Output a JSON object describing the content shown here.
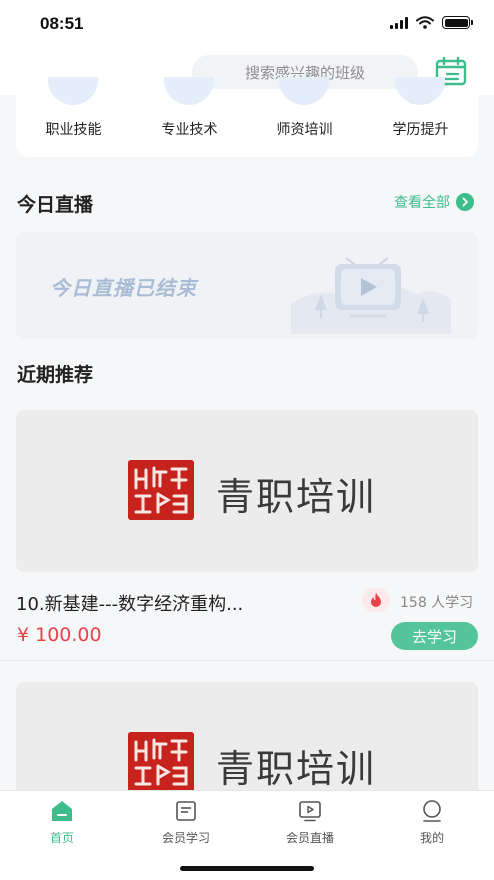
{
  "status_bar": {
    "time": "08:51"
  },
  "header": {
    "search_placeholder": "搜索感兴趣的班级",
    "calendar_icon": "calendar-icon"
  },
  "categories": [
    {
      "label": "职业技能",
      "icon": "category-icon"
    },
    {
      "label": "专业技术",
      "icon": "category-icon"
    },
    {
      "label": "师资培训",
      "icon": "category-icon"
    },
    {
      "label": "学历提升",
      "icon": "category-icon"
    }
  ],
  "today_live": {
    "title": "今日直播",
    "view_all": "查看全部",
    "ended_text": "今日直播已结束"
  },
  "recommend": {
    "title": "近期推荐",
    "courses": [
      {
        "brand": "青职培训",
        "title": "10.新基建---数字经济重构...",
        "learners": "158 人学习",
        "price": "¥ 100.00",
        "action": "去学习"
      },
      {
        "brand": "青职培训"
      }
    ]
  },
  "tabs": [
    {
      "label": "首页",
      "icon": "home-icon",
      "active": true
    },
    {
      "label": "会员学习",
      "icon": "study-icon",
      "active": false
    },
    {
      "label": "会员直播",
      "icon": "live-icon",
      "active": false
    },
    {
      "label": "我的",
      "icon": "profile-icon",
      "active": false
    }
  ],
  "colors": {
    "accent": "#3dbd8c",
    "price": "#e8424b",
    "seal": "#c8221d"
  }
}
